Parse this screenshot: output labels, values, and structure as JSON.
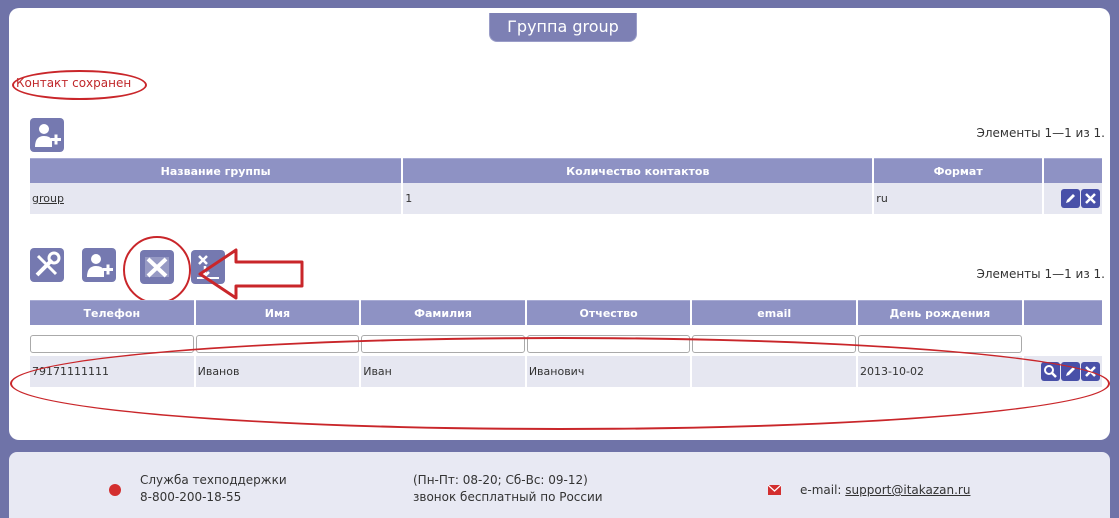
{
  "title": "Группа group",
  "status_message": "Контакт сохранен",
  "groups": {
    "count_text": "Элементы 1—1 из 1.",
    "columns": [
      "Название группы",
      "Количество контактов",
      "Формат"
    ],
    "rows": [
      {
        "name": "group",
        "contacts_count": "1",
        "format": "ru"
      }
    ]
  },
  "contacts": {
    "count_text": "Элементы 1—1 из 1.",
    "columns": [
      "Телефон",
      "Имя",
      "Фамилия",
      "Отчество",
      "email",
      "День рождения"
    ],
    "rows": [
      {
        "phone": "79171111111",
        "first_name": "Иванов",
        "last_name": "Иван",
        "patronymic": "Иванович",
        "email": "",
        "birthday": "2013-10-02"
      }
    ]
  },
  "icons": {
    "add_group": "add-user-icon",
    "settings": "tools-icon",
    "add_contact": "add-user-icon",
    "excel": "excel-icon",
    "export": "export-icon",
    "edit": "pencil-icon",
    "delete": "x-icon",
    "view": "magnifier-icon"
  },
  "footer": {
    "support_title": "Служба техподдержки",
    "support_phone": "8-800-200-18-55",
    "hours": "(Пн-Пт: 08-20; Сб-Вс: 09-12)",
    "free_call": "звонок бесплатный по России",
    "email_label": "e-mail:",
    "email": "support@itakazan.ru"
  },
  "colors": {
    "background": "#6f73a8",
    "header": "#8e92c4",
    "accent": "#4850a8",
    "annotation": "#c9262a"
  }
}
